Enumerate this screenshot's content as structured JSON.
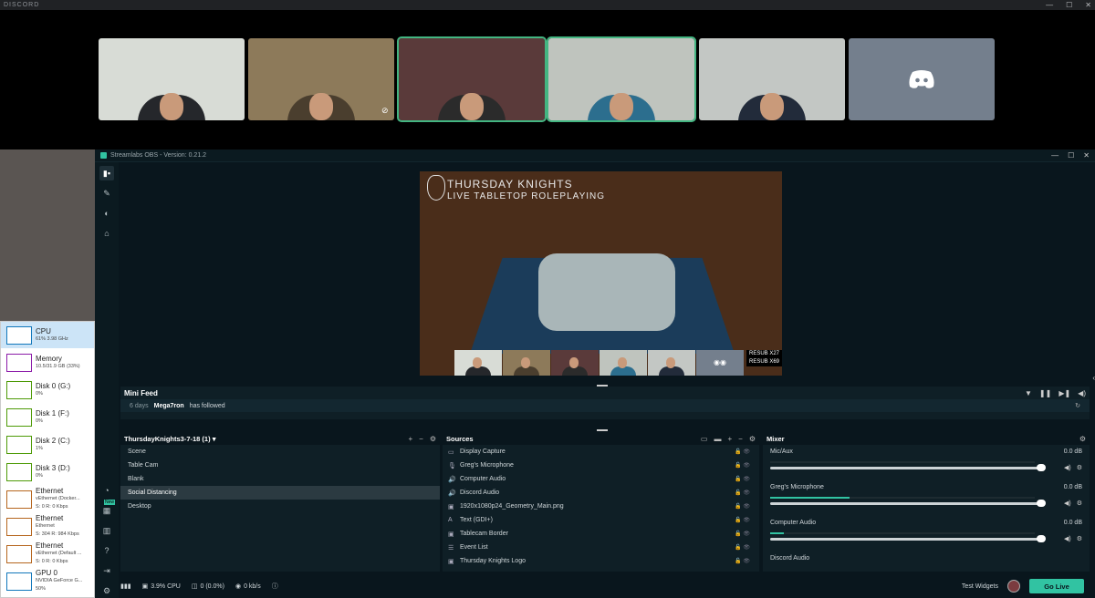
{
  "discord": {
    "title": "DISCORD",
    "controls": [
      "—",
      "☐",
      "✕"
    ],
    "tiles": [
      {
        "bg": "#d8dcd6",
        "shirt": "#25272b",
        "speaking": false
      },
      {
        "bg": "#8d7a5a",
        "shirt": "#4a3e2e",
        "speaking": false,
        "muted": true
      },
      {
        "bg": "#5a3a3a",
        "shirt": "#2b2b2b",
        "speaking": true
      },
      {
        "bg": "#bfc4be",
        "shirt": "#2c6e8e",
        "speaking": true
      },
      {
        "bg": "#c3c7c4",
        "shirt": "#222b3a",
        "speaking": false
      },
      {
        "bg": "#747f8d",
        "blank": true
      }
    ]
  },
  "taskmanager": {
    "items": [
      {
        "name": "CPU",
        "sub": "61% 3.98 GHz",
        "color": "#1177bb",
        "sel": true
      },
      {
        "name": "Memory",
        "sub": "10.5/31.9 GB (33%)",
        "color": "#8b1aa8"
      },
      {
        "name": "Disk 0 (G:)",
        "sub": "0%",
        "color": "#4d9a06"
      },
      {
        "name": "Disk 1 (F:)",
        "sub": "0%",
        "color": "#4d9a06"
      },
      {
        "name": "Disk 2 (C:)",
        "sub": "1%",
        "color": "#4d9a06"
      },
      {
        "name": "Disk 3 (D:)",
        "sub": "0%",
        "color": "#4d9a06"
      },
      {
        "name": "Ethernet",
        "sub": "vEthernet (Docker...",
        "sub2": "S: 0 R: 0 Kbps",
        "color": "#b5651d"
      },
      {
        "name": "Ethernet",
        "sub": "Ethernet",
        "sub2": "S: 304 R: 984 Kbps",
        "color": "#b5651d"
      },
      {
        "name": "Ethernet",
        "sub": "vEthernet (Default ...",
        "sub2": "S: 0 R: 0 Kbps",
        "color": "#b5651d"
      },
      {
        "name": "GPU 0",
        "sub": "NVIDIA GeForce G...",
        "sub2": "50%",
        "color": "#1177bb"
      }
    ]
  },
  "obs": {
    "title": "Streamlabs OBS - Version: 0.21.2",
    "controls": [
      "—",
      "☐",
      "✕"
    ],
    "preview": {
      "logo_line1": "THURSDAY KNIGHTS",
      "logo_line2": "LIVE TABLETOP ROLEPLAYING",
      "resub": [
        "RESUB X27",
        "RESUB X69"
      ]
    },
    "minifeed": {
      "title": "Mini Feed",
      "time": "6 days",
      "user": "Mega7ron",
      "action": "has followed"
    },
    "scenes": {
      "title": "ThursdayKnights3-7-18 (1)",
      "items": [
        "Scene",
        "Table Cam",
        "Blank",
        "Social Distancing",
        "Desktop"
      ],
      "selected": 3
    },
    "sources": {
      "title": "Sources",
      "items": [
        {
          "label": "Display Capture",
          "icon": "▭"
        },
        {
          "label": "Greg's Microphone",
          "icon": "🎙"
        },
        {
          "label": "Computer Audio",
          "icon": "🔊"
        },
        {
          "label": "Discord Audio",
          "icon": "🔊"
        },
        {
          "label": "1920x1080p24_Geometry_Main.png",
          "icon": "▣"
        },
        {
          "label": "Text (GDI+)",
          "icon": "A"
        },
        {
          "label": "Tablecam Border",
          "icon": "▣"
        },
        {
          "label": "Event List",
          "icon": "☰"
        },
        {
          "label": "Thursday Knights Logo",
          "icon": "▣"
        }
      ]
    },
    "mixer": {
      "title": "Mixer",
      "channels": [
        {
          "name": "Mic/Aux",
          "db": "0.0 dB",
          "level": 0
        },
        {
          "name": "Greg's Microphone",
          "db": "0.0 dB",
          "level": 0.3
        },
        {
          "name": "Computer Audio",
          "db": "0.0 dB",
          "level": 0.05
        },
        {
          "name": "Discord Audio",
          "db": "",
          "level": 0
        }
      ]
    },
    "footer": {
      "cpu": "3.9% CPU",
      "dropped": "0 (0.0%)",
      "bitrate": "0 kb/s",
      "test_widgets": "Test Widgets",
      "go_live": "Go Live",
      "new_badge": "New"
    }
  }
}
